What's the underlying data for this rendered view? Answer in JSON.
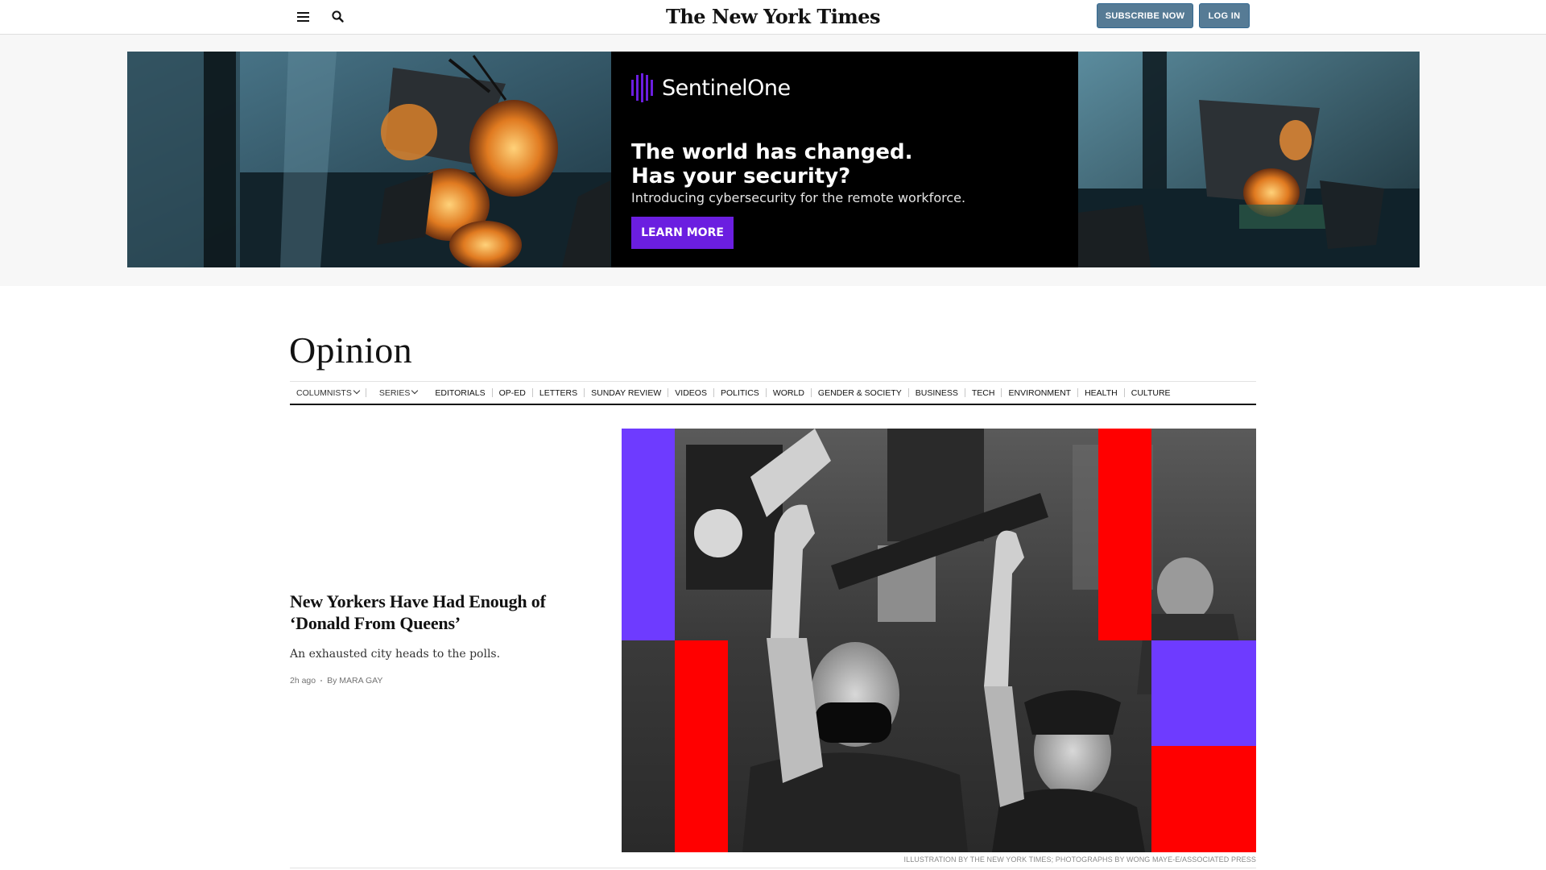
{
  "header": {
    "logo_text": "The New York Times",
    "subscribe_label": "SUBSCRIBE NOW",
    "login_label": "LOG IN"
  },
  "ad": {
    "brand": "SentinelOne",
    "headline_line1": "The world has changed.",
    "headline_line2": "Has your security?",
    "subtext": "Introducing cybersecurity for the remote workforce.",
    "cta": "LEARN MORE",
    "cta_color": "#6b1ee0"
  },
  "section": {
    "title": "Opinion",
    "nav": [
      {
        "label": "COLUMNISTS",
        "dropdown": true
      },
      {
        "label": "SERIES",
        "dropdown": true
      },
      {
        "label": "EDITORIALS"
      },
      {
        "label": "OP-ED"
      },
      {
        "label": "LETTERS"
      },
      {
        "label": "SUNDAY REVIEW"
      },
      {
        "label": "VIDEOS"
      },
      {
        "label": "POLITICS"
      },
      {
        "label": "WORLD"
      },
      {
        "label": "GENDER & SOCIETY"
      },
      {
        "label": "BUSINESS"
      },
      {
        "label": "TECH"
      },
      {
        "label": "ENVIRONMENT"
      },
      {
        "label": "HEALTH"
      },
      {
        "label": "CULTURE"
      }
    ]
  },
  "story": {
    "headline": "New Yorkers Have Had Enough of ‘Donald From Queens’",
    "summary": "An exhausted city heads to the polls.",
    "time": "2h ago",
    "byline": "By MARA GAY",
    "credit": "ILLUSTRATION BY THE NEW YORK TIMES; PHOTOGRAPHS BY WONG MAYE-E/ASSOCIATED PRESS"
  },
  "colors": {
    "button_bg": "#567b95",
    "ad_purple": "#6b1ee0",
    "art_red": "#ff0000",
    "art_purple": "#6e3bff"
  }
}
